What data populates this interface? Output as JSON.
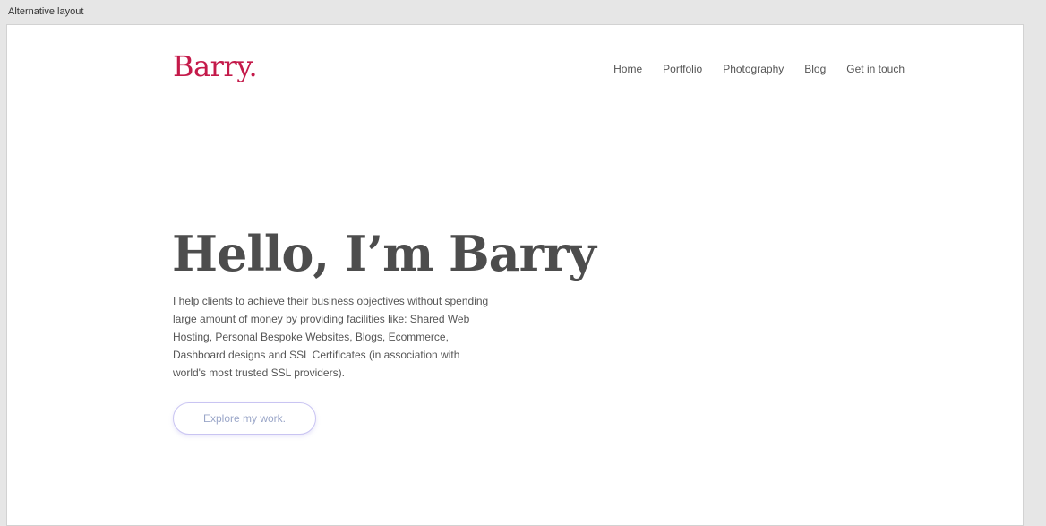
{
  "artboard": {
    "label": "Alternative layout"
  },
  "header": {
    "logo": "Barry.",
    "nav": [
      {
        "label": "Home"
      },
      {
        "label": "Portfolio"
      },
      {
        "label": "Photography"
      },
      {
        "label": "Blog"
      },
      {
        "label": "Get in touch"
      }
    ]
  },
  "hero": {
    "title": "Hello, I’m Barry",
    "description": "I help clients to achieve their business objectives without spending large amount of money by providing facilities like: Shared Web Hosting, Personal Bespoke Websites, Blogs, Ecommerce, Dashboard designs and SSL Certificates (in association with world's most trusted SSL providers).",
    "cta_label": "Explore my work."
  },
  "colors": {
    "brand": "#c41a4a",
    "heading": "#4d4d4d",
    "body_text": "#555555",
    "button_border": "#c9c4f2",
    "button_text": "#9aa6c8"
  }
}
